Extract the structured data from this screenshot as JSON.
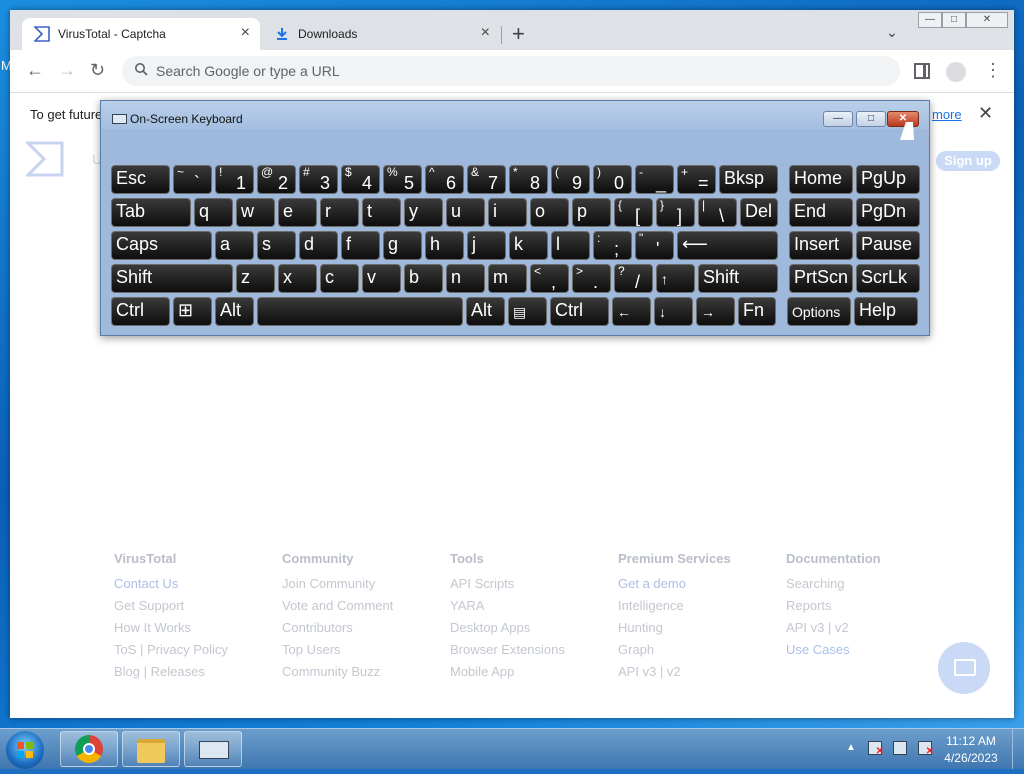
{
  "desktop": {
    "edge_text": "M"
  },
  "browser": {
    "tabs": [
      {
        "title": "VirusTotal - Captcha",
        "close": "×"
      },
      {
        "title": "Downloads",
        "close": "×"
      }
    ],
    "new_tab": "+",
    "tab_search": "⌄",
    "window_controls": {
      "min": "—",
      "max": "□",
      "close": "✕"
    },
    "nav": {
      "back": "←",
      "forward": "→",
      "reload": "↻",
      "menu": "⋮"
    },
    "omnibox": {
      "icon": "🔍",
      "placeholder": "Search Google or type a URL"
    },
    "infobar": {
      "text": "To get future",
      "link": "more",
      "close": "✕"
    },
    "page": {
      "signup": "Sign up",
      "stray_letter": "U",
      "footer": [
        {
          "heading": "VirusTotal",
          "items": [
            "Contact Us",
            "Get Support",
            "How It Works",
            "ToS | Privacy Policy",
            "Blog | Releases"
          ],
          "highlight": [
            0
          ]
        },
        {
          "heading": "Community",
          "items": [
            "Join Community",
            "Vote and Comment",
            "Contributors",
            "Top Users",
            "Community Buzz"
          ],
          "highlight": []
        },
        {
          "heading": "Tools",
          "items": [
            "API Scripts",
            "YARA",
            "Desktop Apps",
            "Browser Extensions",
            "Mobile App"
          ],
          "highlight": []
        },
        {
          "heading": "Premium Services",
          "items": [
            "Get a demo",
            "Intelligence",
            "Hunting",
            "Graph",
            "API v3 | v2"
          ],
          "highlight": [
            0
          ]
        },
        {
          "heading": "Documentation",
          "items": [
            "Searching",
            "Reports",
            "API v3 | v2",
            "Use Cases"
          ],
          "highlight": [
            3
          ]
        }
      ]
    }
  },
  "osk": {
    "title": "On-Screen Keyboard",
    "controls": {
      "min": "—",
      "restore": "□",
      "close": "✕"
    },
    "rows": [
      [
        {
          "l": "Esc",
          "w": 59,
          "n": "esc"
        },
        {
          "t": "~",
          "b": "`",
          "w": 39,
          "n": "tilde"
        },
        {
          "t": "!",
          "b": "1",
          "w": 39,
          "n": "1"
        },
        {
          "t": "@",
          "b": "2",
          "w": 39,
          "n": "2"
        },
        {
          "t": "#",
          "b": "3",
          "w": 39,
          "n": "3"
        },
        {
          "t": "$",
          "b": "4",
          "w": 39,
          "n": "4"
        },
        {
          "t": "%",
          "b": "5",
          "w": 39,
          "n": "5"
        },
        {
          "t": "^",
          "b": "6",
          "w": 39,
          "n": "6"
        },
        {
          "t": "&",
          "b": "7",
          "w": 39,
          "n": "7"
        },
        {
          "t": "*",
          "b": "8",
          "w": 39,
          "n": "8"
        },
        {
          "t": "(",
          "b": "9",
          "w": 39,
          "n": "9"
        },
        {
          "t": ")",
          "b": "0",
          "w": 39,
          "n": "0"
        },
        {
          "t": "-",
          "b": "_",
          "w": 39,
          "n": "minus"
        },
        {
          "t": "+",
          "b": "=",
          "w": 39,
          "n": "equals"
        },
        {
          "l": "Bksp",
          "w": 59,
          "n": "bksp"
        },
        {
          "l": "Home",
          "w": 64,
          "n": "home",
          "g": 8
        },
        {
          "l": "PgUp",
          "w": 64,
          "n": "pgup"
        }
      ],
      [
        {
          "l": "Tab",
          "w": 80,
          "n": "tab"
        },
        {
          "l": "q",
          "w": 39,
          "n": "q"
        },
        {
          "l": "w",
          "w": 39,
          "n": "w"
        },
        {
          "l": "e",
          "w": 39,
          "n": "e"
        },
        {
          "l": "r",
          "w": 39,
          "n": "r"
        },
        {
          "l": "t",
          "w": 39,
          "n": "t"
        },
        {
          "l": "y",
          "w": 39,
          "n": "y"
        },
        {
          "l": "u",
          "w": 39,
          "n": "u"
        },
        {
          "l": "i",
          "w": 39,
          "n": "i"
        },
        {
          "l": "o",
          "w": 39,
          "n": "o"
        },
        {
          "l": "p",
          "w": 39,
          "n": "p"
        },
        {
          "t": "{",
          "b": "[",
          "w": 39,
          "n": "lbracket"
        },
        {
          "t": "}",
          "b": "]",
          "w": 39,
          "n": "rbracket"
        },
        {
          "t": "|",
          "b": "\\",
          "w": 39,
          "n": "backslash"
        },
        {
          "l": "Del",
          "w": 38,
          "n": "del"
        },
        {
          "l": "End",
          "w": 64,
          "n": "end",
          "g": 8
        },
        {
          "l": "PgDn",
          "w": 64,
          "n": "pgdn"
        }
      ],
      [
        {
          "l": "Caps",
          "w": 101,
          "n": "caps"
        },
        {
          "l": "a",
          "w": 39,
          "n": "a"
        },
        {
          "l": "s",
          "w": 39,
          "n": "s"
        },
        {
          "l": "d",
          "w": 39,
          "n": "d"
        },
        {
          "l": "f",
          "w": 39,
          "n": "f"
        },
        {
          "l": "g",
          "w": 39,
          "n": "g"
        },
        {
          "l": "h",
          "w": 39,
          "n": "h"
        },
        {
          "l": "j",
          "w": 39,
          "n": "j"
        },
        {
          "l": "k",
          "w": 39,
          "n": "k"
        },
        {
          "l": "l",
          "w": 39,
          "n": "l"
        },
        {
          "t": ":",
          "b": ";",
          "w": 39,
          "n": "semicolon"
        },
        {
          "t": "\"",
          "b": "'",
          "w": 39,
          "n": "quote"
        },
        {
          "l": "⟵",
          "w": 101,
          "n": "enter"
        },
        {
          "l": "Insert",
          "w": 64,
          "n": "insert",
          "g": 8
        },
        {
          "l": "Pause",
          "w": 64,
          "n": "pause"
        }
      ],
      [
        {
          "l": "Shift",
          "w": 122,
          "n": "lshift"
        },
        {
          "l": "z",
          "w": 39,
          "n": "z"
        },
        {
          "l": "x",
          "w": 39,
          "n": "x"
        },
        {
          "l": "c",
          "w": 39,
          "n": "c"
        },
        {
          "l": "v",
          "w": 39,
          "n": "v"
        },
        {
          "l": "b",
          "w": 39,
          "n": "b"
        },
        {
          "l": "n",
          "w": 39,
          "n": "n"
        },
        {
          "l": "m",
          "w": 39,
          "n": "m"
        },
        {
          "t": "<",
          "b": ",",
          "w": 39,
          "n": "comma"
        },
        {
          "t": ">",
          "b": ".",
          "w": 39,
          "n": "period"
        },
        {
          "t": "?",
          "b": "/",
          "w": 39,
          "n": "slash"
        },
        {
          "l": "↑",
          "w": 39,
          "n": "up",
          "s": 1
        },
        {
          "l": "Shift",
          "w": 80,
          "n": "rshift"
        },
        {
          "l": "PrtScn",
          "w": 64,
          "n": "prtscn",
          "g": 8
        },
        {
          "l": "ScrLk",
          "w": 64,
          "n": "scrlk"
        }
      ],
      [
        {
          "l": "Ctrl",
          "w": 59,
          "n": "lctrl"
        },
        {
          "l": "⊞",
          "w": 39,
          "n": "win"
        },
        {
          "l": "Alt",
          "w": 39,
          "n": "lalt"
        },
        {
          "l": "",
          "w": 206,
          "n": "space"
        },
        {
          "l": "Alt",
          "w": 39,
          "n": "ralt"
        },
        {
          "l": "▤",
          "w": 39,
          "n": "menu",
          "s": 1
        },
        {
          "l": "Ctrl",
          "w": 59,
          "n": "rctrl"
        },
        {
          "l": "←",
          "w": 39,
          "n": "left",
          "s": 1
        },
        {
          "l": "↓",
          "w": 39,
          "n": "down",
          "s": 1
        },
        {
          "l": "→",
          "w": 39,
          "n": "right",
          "s": 1
        },
        {
          "l": "Fn",
          "w": 38,
          "n": "fn"
        },
        {
          "l": "Options",
          "w": 64,
          "n": "options",
          "g": 8,
          "s": 1
        },
        {
          "l": "Help",
          "w": 64,
          "n": "help"
        }
      ]
    ]
  },
  "taskbar": {
    "clock_time": "11:12 AM",
    "clock_date": "4/26/2023",
    "tray_arrow": "▲",
    "tray_mark": "✕"
  },
  "colors": {
    "taskbar": "#3f77b0",
    "desktop": "#0b5fb8",
    "osk_frame": "#9eb9dc",
    "key": "#1a1a1a"
  }
}
